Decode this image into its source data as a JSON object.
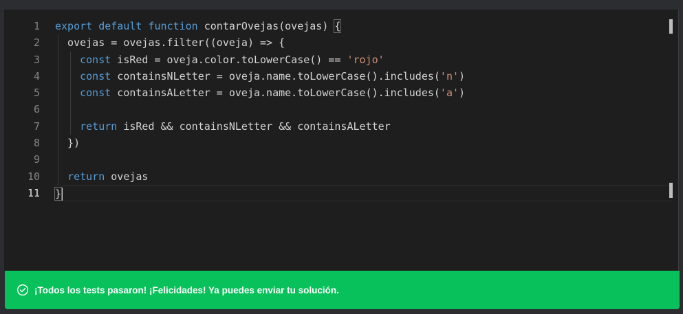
{
  "editor": {
    "line_numbers": [
      "1",
      "2",
      "3",
      "4",
      "5",
      "6",
      "7",
      "8",
      "9",
      "10",
      "11"
    ],
    "lines": [
      [
        {
          "t": "kw",
          "v": "export"
        },
        {
          "t": "p",
          "v": " "
        },
        {
          "t": "kw",
          "v": "default"
        },
        {
          "t": "p",
          "v": " "
        },
        {
          "t": "kw",
          "v": "function"
        },
        {
          "t": "p",
          "v": " contarOvejas(ovejas) {"
        }
      ],
      [
        {
          "t": "p",
          "v": "  ovejas = ovejas.filter((oveja) => {"
        }
      ],
      [
        {
          "t": "p",
          "v": "    "
        },
        {
          "t": "kw",
          "v": "const"
        },
        {
          "t": "p",
          "v": " isRed = oveja.color.toLowerCase() == "
        },
        {
          "t": "str",
          "v": "'rojo'"
        }
      ],
      [
        {
          "t": "p",
          "v": "    "
        },
        {
          "t": "kw",
          "v": "const"
        },
        {
          "t": "p",
          "v": " containsNLetter = oveja.name.toLowerCase().includes("
        },
        {
          "t": "str",
          "v": "'n'"
        },
        {
          "t": "p",
          "v": ")"
        }
      ],
      [
        {
          "t": "p",
          "v": "    "
        },
        {
          "t": "kw",
          "v": "const"
        },
        {
          "t": "p",
          "v": " containsALetter = oveja.name.toLowerCase().includes("
        },
        {
          "t": "str",
          "v": "'a'"
        },
        {
          "t": "p",
          "v": ")"
        }
      ],
      [
        {
          "t": "p",
          "v": ""
        }
      ],
      [
        {
          "t": "p",
          "v": "    "
        },
        {
          "t": "kw",
          "v": "return"
        },
        {
          "t": "p",
          "v": " isRed && containsNLetter && containsALetter"
        }
      ],
      [
        {
          "t": "p",
          "v": "  })"
        }
      ],
      [
        {
          "t": "p",
          "v": ""
        }
      ],
      [
        {
          "t": "p",
          "v": "  "
        },
        {
          "t": "kw",
          "v": "return"
        },
        {
          "t": "p",
          "v": " ovejas"
        }
      ],
      [
        {
          "t": "p",
          "v": "}"
        }
      ]
    ],
    "active_line": 11
  },
  "toast": {
    "message": "¡Todos los tests pasaron! ¡Felicidades! Ya puedes enviar tu solución.",
    "icon": "check-circle-icon",
    "color": "#09c15a"
  },
  "colors": {
    "editor_bg": "#1e1e1e",
    "keyword": "#569cd6",
    "string": "#ce9178",
    "text": "#d4d4d4"
  }
}
